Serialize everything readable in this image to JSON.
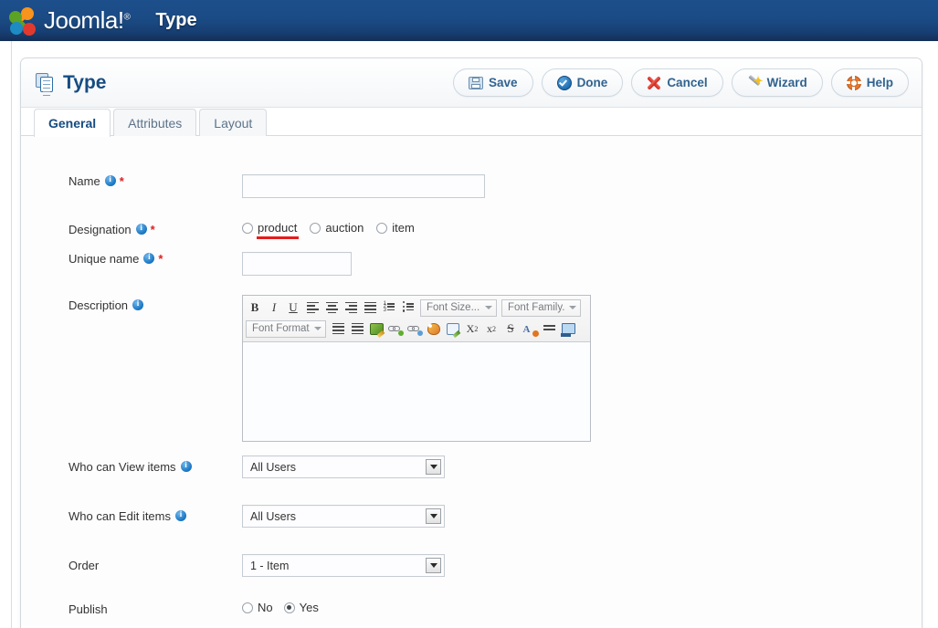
{
  "topbar": {
    "brand": "Joomla!",
    "brand_reg": "®",
    "title": "Type",
    "logo_icon": "joomla-logo-icon",
    "bg_start": "#1c4f8b",
    "bg_end": "#142f55"
  },
  "panel": {
    "title": "Type",
    "title_icon": "document-copy-icon",
    "toolbar": [
      {
        "label": "Save",
        "icon": "floppy-disk-icon",
        "key": "save"
      },
      {
        "label": "Done",
        "icon": "check-circle-icon",
        "key": "done"
      },
      {
        "label": "Cancel",
        "icon": "red-x-icon",
        "key": "cancel"
      },
      {
        "label": "Wizard",
        "icon": "magic-wand-icon",
        "key": "wizard"
      },
      {
        "label": "Help",
        "icon": "lifebuoy-icon",
        "key": "help"
      }
    ],
    "tabs": [
      {
        "label": "General",
        "active": true
      },
      {
        "label": "Attributes",
        "active": false
      },
      {
        "label": "Layout",
        "active": false
      }
    ]
  },
  "form": {
    "name": {
      "label": "Name",
      "info_icon": "info-icon",
      "required_mark": "*",
      "value": "",
      "placeholder": ""
    },
    "designation": {
      "label": "Designation",
      "info_icon": "info-icon",
      "required_mark": "*",
      "options": [
        {
          "label": "product",
          "checked": false,
          "annotated": true
        },
        {
          "label": "auction",
          "checked": false,
          "annotated": false
        },
        {
          "label": "item",
          "checked": false,
          "annotated": false
        }
      ],
      "annotation_color": "#e81c1c"
    },
    "unique_name": {
      "label": "Unique name",
      "info_icon": "info-icon",
      "required_mark": "*",
      "value": "",
      "placeholder": ""
    },
    "description": {
      "label": "Description",
      "info_icon": "info-icon",
      "value": "",
      "editor": {
        "row1": [
          {
            "name": "bold-icon",
            "glyph": "B"
          },
          {
            "name": "italic-icon",
            "glyph": "I"
          },
          {
            "name": "underline-icon",
            "glyph": "U"
          },
          {
            "name": "align-left-icon",
            "glyph": ""
          },
          {
            "name": "align-center-icon",
            "glyph": ""
          },
          {
            "name": "align-right-icon",
            "glyph": ""
          },
          {
            "name": "align-justify-icon",
            "glyph": ""
          },
          {
            "name": "ordered-list-icon",
            "glyph": ""
          },
          {
            "name": "unordered-list-icon",
            "glyph": ""
          }
        ],
        "font_size": "Font Size...",
        "font_family": "Font Family.",
        "font_format": "Font Format",
        "row2": [
          {
            "name": "indent-icon"
          },
          {
            "name": "outdent-icon"
          },
          {
            "name": "edit-pencil-icon"
          },
          {
            "name": "insert-link-icon"
          },
          {
            "name": "unlink-icon"
          },
          {
            "name": "text-color-icon"
          },
          {
            "name": "edit-source-icon"
          },
          {
            "name": "subscript-icon"
          },
          {
            "name": "superscript-icon"
          },
          {
            "name": "strikethrough-icon"
          },
          {
            "name": "remove-format-icon"
          },
          {
            "name": "horizontal-rule-icon"
          },
          {
            "name": "insert-image-icon"
          }
        ]
      }
    },
    "who_can_view": {
      "label": "Who can View items",
      "info_icon": "info-icon",
      "value": "All Users",
      "dropdown_icon": "caret-down-icon"
    },
    "who_can_edit": {
      "label": "Who can Edit items",
      "info_icon": "info-icon",
      "value": "All Users",
      "dropdown_icon": "caret-down-icon"
    },
    "order": {
      "label": "Order",
      "value": "1 - Item",
      "dropdown_icon": "caret-down-icon"
    },
    "publish": {
      "label": "Publish",
      "options": [
        {
          "label": "No",
          "checked": false
        },
        {
          "label": "Yes",
          "checked": true
        }
      ]
    }
  }
}
